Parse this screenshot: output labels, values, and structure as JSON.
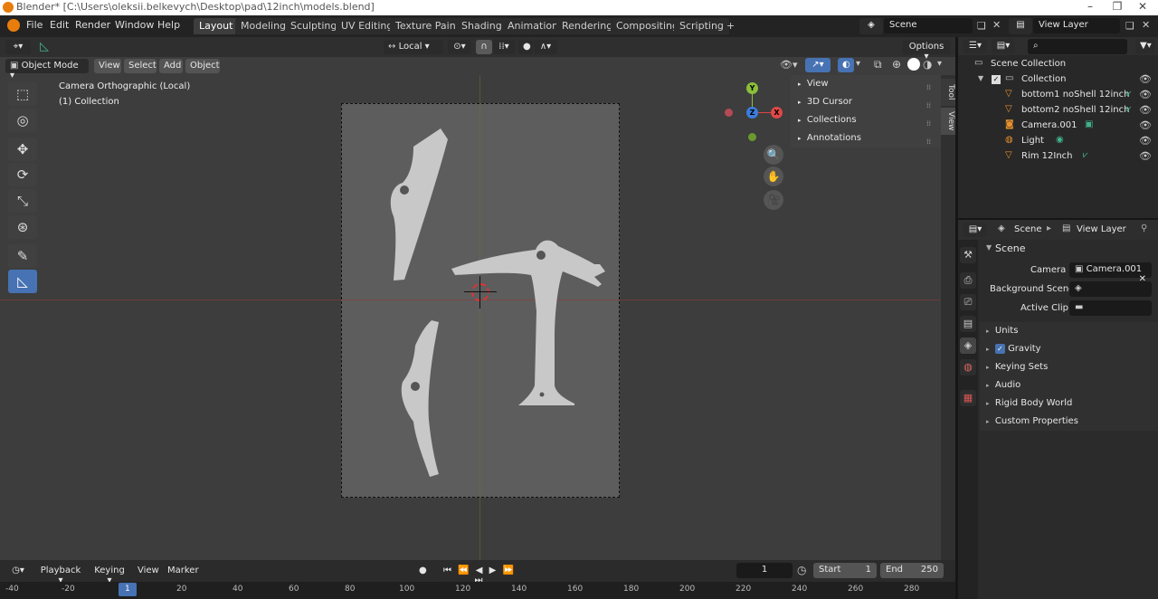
{
  "window": {
    "title": "Blender* [C:\\Users\\oleksii.belkevych\\Desktop\\pad\\12inch\\models.blend]"
  },
  "menus": [
    "File",
    "Edit",
    "Render",
    "Window",
    "Help"
  ],
  "workspaces": [
    "Layout",
    "Modeling",
    "Sculpting",
    "UV Editing",
    "Texture Paint",
    "Shading",
    "Animation",
    "Rendering",
    "Compositing",
    "Scripting"
  ],
  "workspace_add": "+",
  "scene": {
    "name": "Scene",
    "view_layer": "View Layer"
  },
  "viewport_header": {
    "transform": "Local",
    "options": "Options"
  },
  "viewport_header2": {
    "mode": "Object Mode",
    "menus": [
      "View",
      "Select",
      "Add",
      "Object"
    ]
  },
  "overlay_text": {
    "line1": "Camera Orthographic (Local)",
    "line2": "(1) Collection"
  },
  "gizmo": {
    "y": "Y",
    "z": "Z",
    "x": "X"
  },
  "npanel": {
    "items": [
      "View",
      "3D Cursor",
      "Collections",
      "Annotations"
    ],
    "tabs": [
      "Tool",
      "View"
    ]
  },
  "outliner": {
    "root": "Scene Collection",
    "collection": "Collection",
    "items": [
      "bottom1 noShell 12inch",
      "bottom2 noShell 12inch",
      "Camera.001",
      "Light",
      "Rim 12Inch"
    ]
  },
  "properties": {
    "breadcrumb": [
      "Scene",
      "View Layer"
    ],
    "section": "Scene",
    "camera_label": "Camera",
    "camera_value": "Camera.001",
    "background_label": "Background Scene",
    "clip_label": "Active Clip",
    "panels": [
      "Units",
      "Gravity",
      "Keying Sets",
      "Audio",
      "Rigid Body World",
      "Custom Properties"
    ]
  },
  "timeline": {
    "menus": [
      "Playback",
      "Keying",
      "View",
      "Marker"
    ],
    "frame": "1",
    "start_label": "Start",
    "start": "1",
    "end_label": "End",
    "end": "250",
    "ticks": [
      "-40",
      "-20",
      "1",
      "20",
      "40",
      "60",
      "80",
      "100",
      "120",
      "140",
      "160",
      "180",
      "200",
      "220",
      "240",
      "260",
      "280"
    ]
  },
  "colors": {
    "accent": "#4772b3",
    "object": "#e8912d",
    "data": "#41b48d"
  }
}
